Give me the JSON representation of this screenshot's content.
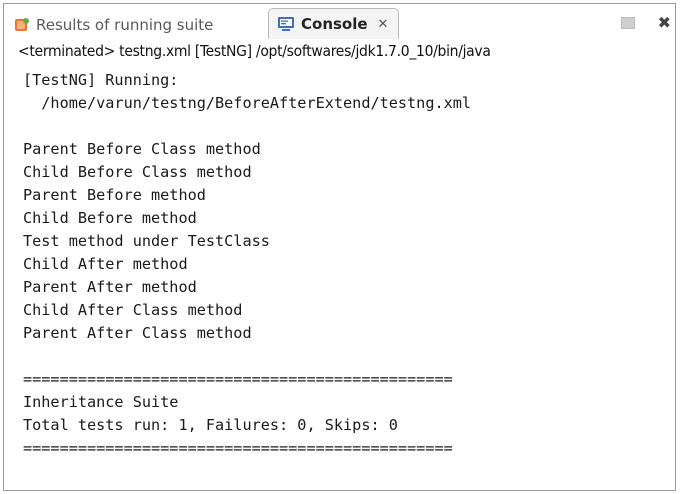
{
  "tabs": {
    "results_label": "Results of running suite",
    "console_label": "Console",
    "console_close_glyph": "✕"
  },
  "toolbar": {
    "maximize_glyph": "✖"
  },
  "console": {
    "description": "<terminated> testng.xml [TestNG] /opt/softwares/jdk1.7.0_10/bin/java",
    "lines": [
      "[TestNG] Running:",
      "  /home/varun/testng/BeforeAfterExtend/testng.xml",
      "",
      "Parent Before Class method",
      "Child Before Class method",
      "Parent Before method",
      "Child Before method",
      "Test method under TestClass",
      "Child After method",
      "Parent After method",
      "Child After Class method",
      "Parent After Class method",
      "",
      "===============================================",
      "Inheritance Suite",
      "Total tests run: 1, Failures: 0, Skips: 0",
      "==============================================="
    ]
  },
  "colors": {
    "tab_active_bg": "#f4f4f4",
    "text": "#1a1a1a"
  }
}
